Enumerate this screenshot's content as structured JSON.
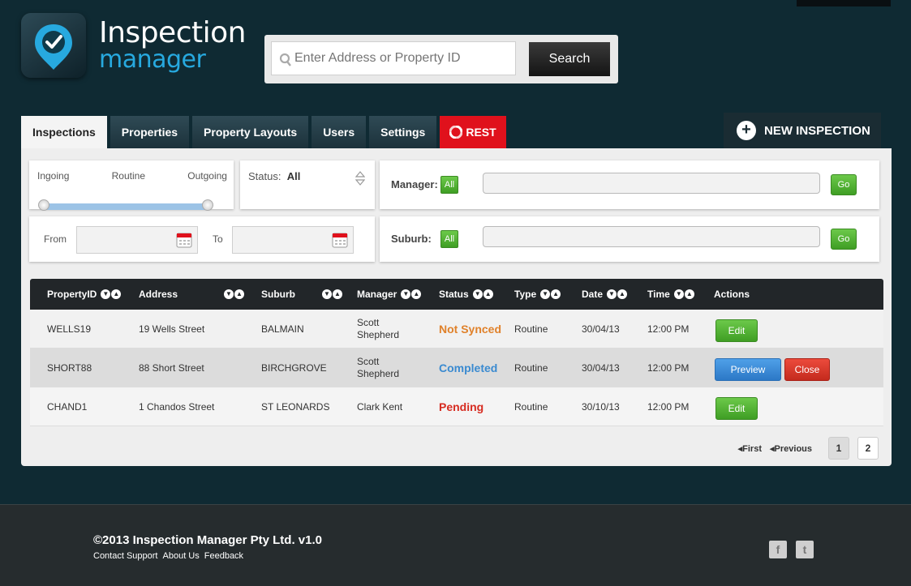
{
  "app": {
    "title_line1": "Inspection",
    "title_line2": "manager"
  },
  "search": {
    "placeholder": "Enter Address or Property ID",
    "button_label": "Search"
  },
  "tabs": [
    {
      "label": "Inspections",
      "active": true
    },
    {
      "label": "Properties"
    },
    {
      "label": "Property Layouts"
    },
    {
      "label": "Users"
    },
    {
      "label": "Settings"
    },
    {
      "label": "REST"
    }
  ],
  "new_inspection_label": "NEW INSPECTION",
  "filters": {
    "slider": {
      "labels": [
        "Ingoing",
        "Routine",
        "Outgoing"
      ]
    },
    "status": {
      "label": "Status:",
      "value": "All"
    },
    "from_label": "From",
    "to_label": "To",
    "manager": {
      "label": "Manager:",
      "all_label": "All",
      "go_label": "Go"
    },
    "suburb": {
      "label": "Suburb:",
      "all_label": "All",
      "go_label": "Go"
    }
  },
  "table": {
    "headers": [
      "PropertyID",
      "Address",
      "Suburb",
      "Manager",
      "Status",
      "Type",
      "Date",
      "Time",
      "Actions"
    ],
    "rows": [
      {
        "id": "WELLS19",
        "address": "19 Wells Street",
        "suburb": "BALMAIN",
        "manager_l1": "Scott",
        "manager_l2": "Shepherd",
        "status": "Not Synced",
        "status_color": "#e0812a",
        "type": "Routine",
        "date": "30/04/13",
        "time": "12:00 PM",
        "actions": [
          "Edit"
        ]
      },
      {
        "id": "SHORT88",
        "address": "88 Short Street",
        "suburb": "BIRCHGROVE",
        "manager_l1": "Scott",
        "manager_l2": "Shepherd",
        "status": "Completed",
        "status_color": "#3a8ad0",
        "type": "Routine",
        "date": "30/04/13",
        "time": "12:00 PM",
        "actions": [
          "Preview",
          "Close"
        ]
      },
      {
        "id": "CHAND1",
        "address": "1 Chandos Street",
        "suburb": "ST LEONARDS",
        "manager_l1": "Clark Kent",
        "manager_l2": "",
        "status": "Pending",
        "status_color": "#d62b20",
        "type": "Routine",
        "date": "30/10/13",
        "time": "12:00 PM",
        "actions": [
          "Edit"
        ]
      }
    ]
  },
  "pagination": {
    "first_label": "First",
    "previous_label": "Previous",
    "pages": [
      "1",
      "2"
    ],
    "current": "1"
  },
  "footer": {
    "copyright": "©2013 Inspection Manager Pty Ltd. v1.0",
    "links": [
      "Contact Support",
      "About Us",
      "Feedback"
    ],
    "social": [
      {
        "icon": "facebook-icon",
        "glyph": "f"
      },
      {
        "icon": "twitter-icon",
        "glyph": "t"
      }
    ]
  },
  "colors": {
    "background": "#0f2a33",
    "accent_blue": "#27a9df",
    "green_button": "#4cae2e",
    "rest_tab": "#e0111c"
  }
}
